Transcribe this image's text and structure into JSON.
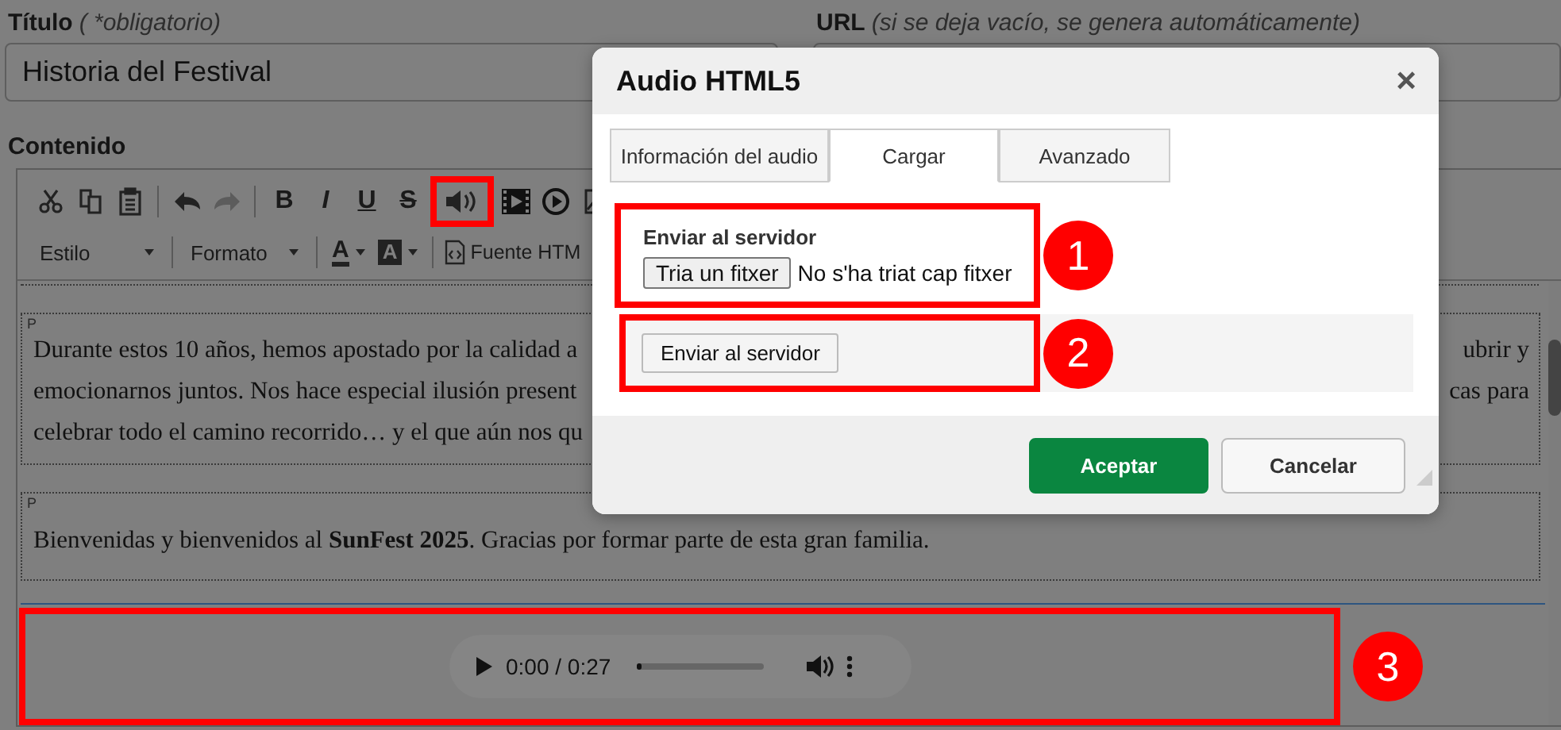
{
  "form": {
    "title_label": "Título",
    "title_hint": "( *obligatorio)",
    "title_value": "Historia del Festival",
    "url_label": "URL",
    "url_hint": "(si se deja vacío, se genera automáticamente)",
    "content_label": "Contenido"
  },
  "toolbar": {
    "format_buttons": [
      {
        "label": "B",
        "kind": "bold"
      },
      {
        "label": "I",
        "kind": "italic"
      },
      {
        "label": "U",
        "kind": "underline"
      },
      {
        "label": "S",
        "kind": "strike"
      }
    ],
    "style_dropdown": "Estilo",
    "format_dropdown": "Formato",
    "text_color": "A",
    "background_color": "A",
    "source_button": "Fuente HTM"
  },
  "paragraphs": [
    {
      "tag": "P",
      "lines": [
        {
          "left": "Durante estos 10 años, hemos apostado por la calidad a",
          "right": "ubrir y"
        },
        {
          "left": "emocionarnos juntos. Nos hace especial ilusión present",
          "right": "cas para"
        },
        {
          "left": "celebrar todo el camino recorrido… y el que aún nos qu"
        }
      ]
    },
    {
      "tag": "P",
      "lines": [
        {
          "left": "Bienvenidas y bienvenidos al **SunFest 2025**. Gracias por formar parte de esta gran familia."
        }
      ]
    }
  ],
  "audio_player": {
    "time": "0:00 / 0:27",
    "level": 0.04
  },
  "dialog": {
    "title": "Audio HTML5",
    "close": "×",
    "tabs": [
      {
        "label": "Información del audio",
        "selected": false
      },
      {
        "label": "Cargar",
        "selected": true
      },
      {
        "label": "Avanzado",
        "selected": false
      }
    ],
    "upload_label": "Enviar al servidor",
    "file_button": "Tria un fitxer",
    "file_status": "No s'ha triat cap fitxer",
    "send_button": "Enviar al servidor",
    "buttons": [
      {
        "label": "Aceptar",
        "kind": "primary"
      },
      {
        "label": "Cancelar",
        "kind": "secondary"
      }
    ]
  },
  "annotations": [
    "1",
    "2",
    "3"
  ]
}
